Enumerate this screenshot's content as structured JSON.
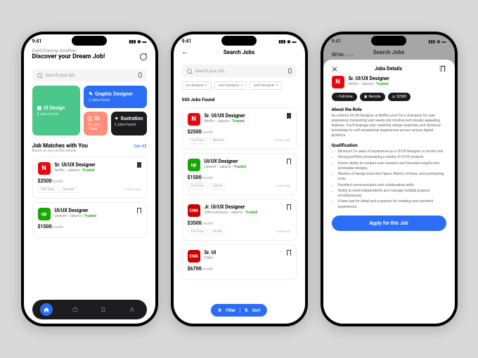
{
  "statusbar": {
    "time": "9:41"
  },
  "home": {
    "greeting": "Good Evening Jonathan",
    "headline": "Discover your Dream Job!",
    "search_placeholder": "Search your job..",
    "categories": {
      "ui_design": {
        "title": "UI Design",
        "sub": "8 Jobs Found"
      },
      "graphic": {
        "title": "Graphic Designer",
        "sub": "2 Jobs Found"
      },
      "threed": {
        "title": "3D",
        "sub": "12 Jobs Found"
      },
      "illus": {
        "title": "Ilustration",
        "sub": "3 Jobs Found"
      }
    },
    "matches": {
      "title": "Job Matches with You",
      "sub": "Based on your profile details",
      "see_all": "See All"
    },
    "jobs": [
      {
        "title": "Sr. UI/UX Designer",
        "company": "Netflix",
        "location": "Jakarta",
        "trusted": "Trusted",
        "salary": "$2500",
        "period": "/month",
        "tags": [
          "Full-Time",
          "Remote"
        ],
        "time": "2 Hours ago",
        "logo": "N",
        "logo_class": "netflix"
      },
      {
        "title": "UI/UX Designer",
        "company": "Upwork",
        "location": "Jakarta",
        "trusted": "Trusted",
        "salary": "$1500",
        "period": "/month",
        "tags": [],
        "time": "",
        "logo": "up",
        "logo_class": "upwork"
      }
    ]
  },
  "search": {
    "title": "Search Jobs",
    "placeholder": "Search your job..",
    "chips": [
      "ux designer",
      "uiux designer",
      "web designer"
    ],
    "count": "550 Jobs Found",
    "filter": "Filter",
    "sort": "Sort",
    "jobs": [
      {
        "title": "Sr. UI/UX Designer",
        "company": "Netflix",
        "location": "Jakarta",
        "trusted": "Trusted",
        "salary": "$2500",
        "period": "/month",
        "tags": [
          "Full-Time",
          "Remote"
        ],
        "time": "3 hours ago",
        "logo": "N",
        "logo_class": "netflix"
      },
      {
        "title": "UI/UX Designer",
        "company": "Upwork",
        "location": "Jakarta",
        "trusted": "Trusted",
        "salary": "$1500",
        "period": "/month",
        "tags": [
          "Full-Time",
          "Hybrid"
        ],
        "time": "1 week ago",
        "logo": "up",
        "logo_class": "upwork"
      },
      {
        "title": "Jr. UI/UX Designer",
        "company": "CNN Indonesia",
        "location": "Jakarta",
        "trusted": "Trusted",
        "salary": "$3500",
        "period": "/month",
        "tags": [
          "Full-Time",
          "Onsite"
        ],
        "time": "1 week ago",
        "logo": "CNN",
        "logo_class": "cnn"
      },
      {
        "title": "Sr. UI",
        "company": "CNN I",
        "location": "",
        "trusted": "",
        "salary": "$6700",
        "period": "/month",
        "tags": [],
        "time": "",
        "logo": "CNN",
        "logo_class": "cnn"
      }
    ]
  },
  "detail": {
    "header": "Jobs Details",
    "job": {
      "title": "Sr. UI/UX Designer",
      "company": "Netflix",
      "location": "Jakarta",
      "trusted": "Trusted",
      "logo": "N"
    },
    "pills": {
      "type": "Full-time",
      "mode": "Remote",
      "salary": "$2500"
    },
    "about_h": "About the Role",
    "about_p": "As a Senior UI/UX Designer at Netflix, you'll be a champion for user experience, translating user needs into intuitive and visually appealing features. You'll leverage your creativity, design expertise, and technical knowledge to craft exceptional experiences across various digital products.",
    "qual_h": "Qualification",
    "qual": [
      "Minimum 5+ years of experience as a UI/UX Designer or similar role.",
      "Strong portfolio showcasing a variety of UI/UX projects.",
      "Proven ability to conduct user research and translate insights into actionable designs.",
      "Mastery of design tools like Figma, Sketch, InVision, and prototyping tools.",
      "Excellent communication and collaboration skills.",
      "Ability to work independently and manage multiple projects simultaneously.",
      "A keen eye for detail and a passion for creating user-centered experiences."
    ],
    "apply": "Apply for this Job",
    "behind_salary": "$6700",
    "behind_period": "/month"
  }
}
